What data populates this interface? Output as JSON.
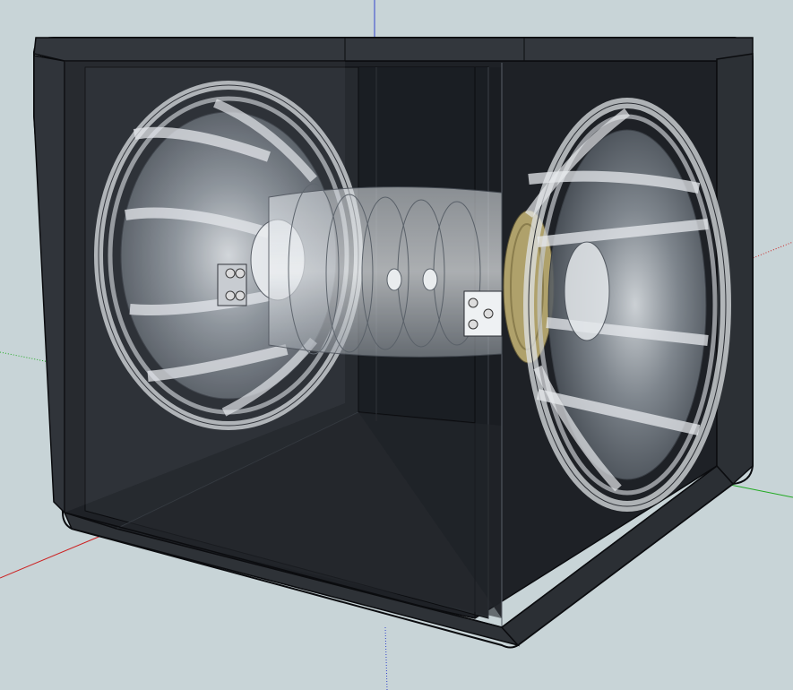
{
  "app": {
    "viewport_background": "#c8d4d7"
  },
  "scene": {
    "axis_colors": {
      "red_axis": "#cc2222",
      "green_axis": "#22aa22",
      "blue_axis": "#2233cc"
    },
    "box_color": "#2a2d33",
    "edge_color": "#0c0d10",
    "glass_color": "#b9bfc4",
    "coil_color": "#c9b878"
  }
}
